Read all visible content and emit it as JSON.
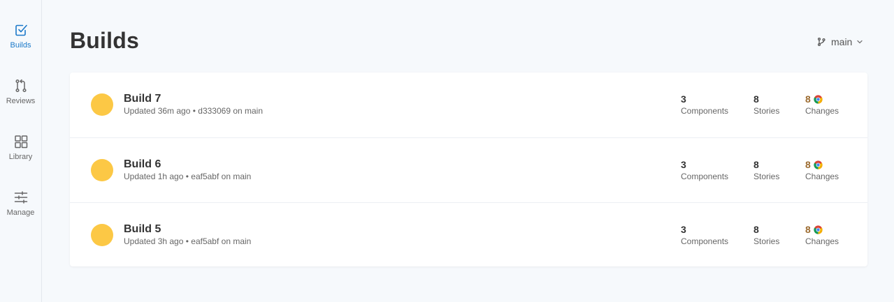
{
  "sidebar": {
    "items": [
      {
        "label": "Builds",
        "icon": "builds-checkbox-icon",
        "active": true
      },
      {
        "label": "Reviews",
        "icon": "pull-request-icon",
        "active": false
      },
      {
        "label": "Library",
        "icon": "grid-icon",
        "active": false
      },
      {
        "label": "Manage",
        "icon": "sliders-icon",
        "active": false
      }
    ]
  },
  "header": {
    "title": "Builds",
    "branch": "main"
  },
  "builds": [
    {
      "title": "Build 7",
      "meta": "Updated 36m ago • d333069 on main",
      "components": "3",
      "components_label": "Components",
      "stories": "8",
      "stories_label": "Stories",
      "changes": "8",
      "changes_label": "Changes",
      "browser_icon": "chrome-icon"
    },
    {
      "title": "Build 6",
      "meta": "Updated 1h ago • eaf5abf on main",
      "components": "3",
      "components_label": "Components",
      "stories": "8",
      "stories_label": "Stories",
      "changes": "8",
      "changes_label": "Changes",
      "browser_icon": "chrome-icon"
    },
    {
      "title": "Build 5",
      "meta": "Updated 3h ago • eaf5abf on main",
      "components": "3",
      "components_label": "Components",
      "stories": "8",
      "stories_label": "Stories",
      "changes": "8",
      "changes_label": "Changes",
      "browser_icon": "chrome-icon"
    }
  ],
  "colors": {
    "accent": "#1b79c9",
    "status_pending": "#fcc845",
    "changes_text": "#9c6b2f",
    "background": "#f6f9fc"
  }
}
